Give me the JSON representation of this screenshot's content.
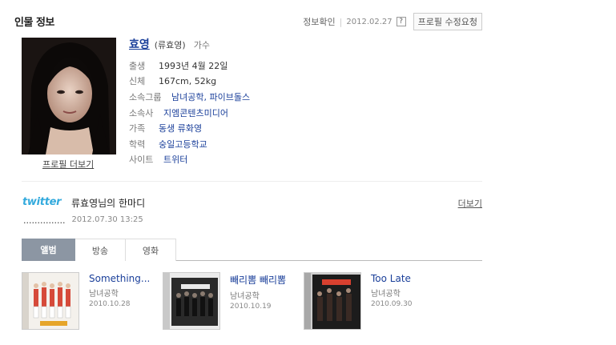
{
  "header": {
    "title": "인물 정보",
    "info_check": "정보확인",
    "date": "2012.02.27",
    "help_symbol": "?",
    "request_button": "프로필 수정요청"
  },
  "profile": {
    "name": "효영",
    "name_korean": "(류효영)",
    "job": "가수",
    "more_link": "프로필 더보기",
    "rows": [
      {
        "label": "출생",
        "value": "1993년 4월 22일",
        "link": false
      },
      {
        "label": "신체",
        "value": "167cm, 52kg",
        "link": false
      },
      {
        "label": "소속그룹",
        "value": "남녀공학, 파이브돌스",
        "link": true
      },
      {
        "label": "소속사",
        "value": "지엠콘텐츠미디어",
        "link": true
      },
      {
        "label": "가족",
        "value": "동생 류화영",
        "link": true
      },
      {
        "label": "학력",
        "value": "숭일고등학교",
        "link": true
      },
      {
        "label": "사이트",
        "value": "트위터",
        "link": true
      }
    ]
  },
  "twitter": {
    "logo": "twitter",
    "title": "류효영님의 한마디",
    "more": "더보기",
    "tweet_text": "...............",
    "tweet_time": "2012.07.30 13:25"
  },
  "tabs": [
    "앨범",
    "방송",
    "영화"
  ],
  "albums": [
    {
      "title": "Something...",
      "artist": "남녀공학",
      "date": "2010.10.28"
    },
    {
      "title": "빼리뽐 빼리뽐",
      "artist": "남녀공학",
      "date": "2010.10.19"
    },
    {
      "title": "Too Late",
      "artist": "남녀공학",
      "date": "2010.09.30"
    }
  ],
  "colors": {
    "link": "#1a3f9a",
    "twitter": "#33aadd",
    "tab_active": "#8c96a3"
  }
}
